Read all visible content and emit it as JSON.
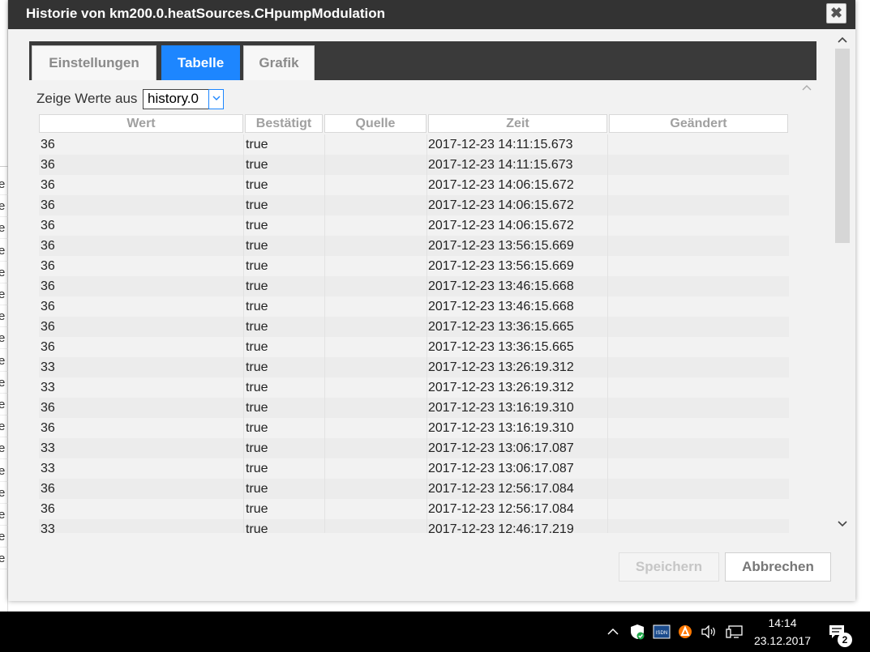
{
  "dialog": {
    "title": "Historie von km200.0.heatSources.CHpumpModulation",
    "close_glyph": "✖"
  },
  "tabs": [
    {
      "label": "Einstellungen"
    },
    {
      "label": "Tabelle"
    },
    {
      "label": "Grafik"
    }
  ],
  "filter": {
    "label": "Zeige Werte aus",
    "selected": "history.0"
  },
  "table": {
    "columns": [
      "Wert",
      "Bestätigt",
      "Quelle",
      "Zeit",
      "Geändert"
    ],
    "rows": [
      {
        "wert": "36",
        "best": "true",
        "zeit": "2017-12-23 14:11:15.673"
      },
      {
        "wert": "36",
        "best": "true",
        "zeit": "2017-12-23 14:11:15.673"
      },
      {
        "wert": "36",
        "best": "true",
        "zeit": "2017-12-23 14:06:15.672"
      },
      {
        "wert": "36",
        "best": "true",
        "zeit": "2017-12-23 14:06:15.672"
      },
      {
        "wert": "36",
        "best": "true",
        "zeit": "2017-12-23 14:06:15.672"
      },
      {
        "wert": "36",
        "best": "true",
        "zeit": "2017-12-23 13:56:15.669"
      },
      {
        "wert": "36",
        "best": "true",
        "zeit": "2017-12-23 13:56:15.669"
      },
      {
        "wert": "36",
        "best": "true",
        "zeit": "2017-12-23 13:46:15.668"
      },
      {
        "wert": "36",
        "best": "true",
        "zeit": "2017-12-23 13:46:15.668"
      },
      {
        "wert": "36",
        "best": "true",
        "zeit": "2017-12-23 13:36:15.665"
      },
      {
        "wert": "36",
        "best": "true",
        "zeit": "2017-12-23 13:36:15.665"
      },
      {
        "wert": "33",
        "best": "true",
        "zeit": "2017-12-23 13:26:19.312"
      },
      {
        "wert": "33",
        "best": "true",
        "zeit": "2017-12-23 13:26:19.312"
      },
      {
        "wert": "36",
        "best": "true",
        "zeit": "2017-12-23 13:16:19.310"
      },
      {
        "wert": "36",
        "best": "true",
        "zeit": "2017-12-23 13:16:19.310"
      },
      {
        "wert": "33",
        "best": "true",
        "zeit": "2017-12-23 13:06:17.087"
      },
      {
        "wert": "33",
        "best": "true",
        "zeit": "2017-12-23 13:06:17.087"
      },
      {
        "wert": "36",
        "best": "true",
        "zeit": "2017-12-23 12:56:17.084"
      },
      {
        "wert": "36",
        "best": "true",
        "zeit": "2017-12-23 12:56:17.084"
      },
      {
        "wert": "33",
        "best": "true",
        "zeit": "2017-12-23 12:46:17.219"
      }
    ]
  },
  "buttons": {
    "save": "Speichern",
    "cancel": "Abbrechen"
  },
  "background_page": {
    "row_letter": "e"
  },
  "taskbar": {
    "time": "14:14",
    "date": "23.12.2017",
    "notification_count": "2",
    "isdn_label": "ISDN"
  },
  "colors": {
    "accent": "#1d86ff",
    "titlebar": "#333333"
  }
}
